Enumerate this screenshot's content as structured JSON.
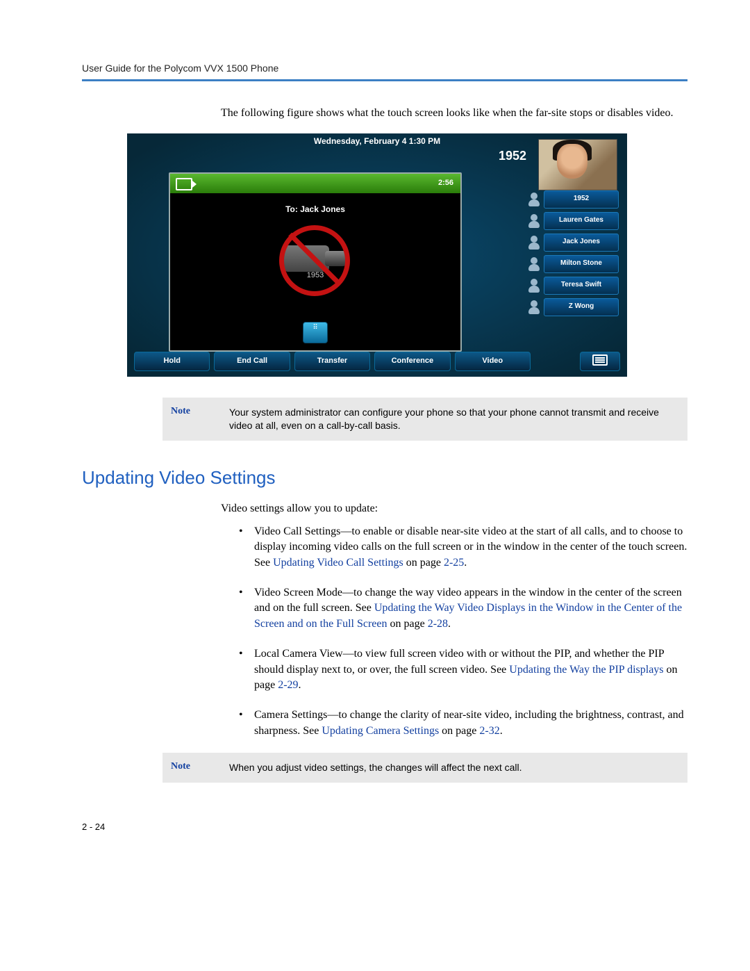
{
  "header": "User Guide for the Polycom VVX 1500 Phone",
  "intro": "The following figure shows what the touch screen looks like when the far-site stops or disables video.",
  "phone": {
    "datetime": "Wednesday, February 4  1:30 PM",
    "extension": "1952",
    "call_time": "2:56",
    "to_label": "To: Jack Jones",
    "caller_number": "1953",
    "contacts": [
      "1952",
      "Lauren Gates",
      "Jack Jones",
      "Milton Stone",
      "Teresa Swift",
      "Z Wong"
    ],
    "softkeys": [
      "Hold",
      "End Call",
      "Transfer",
      "Conference",
      "Video"
    ]
  },
  "note1_label": "Note",
  "note1_text": "Your system administrator can configure your phone so that your phone cannot transmit and receive video at all, even on a call-by-call basis.",
  "section_title": "Updating Video Settings",
  "body_lead": "Video settings allow you to update:",
  "bullets": {
    "b1a": "Video Call Settings—to enable or disable near-site video at the start of all calls, and to choose to display incoming video calls on the full screen or in the window in the center of the touch screen. See ",
    "b1link": "Updating Video Call Settings",
    "b1b": " on page ",
    "b1page": "2-25",
    "b2a": "Video Screen Mode—to change the way video appears in the window in the center of the screen and on the full screen. See ",
    "b2link": "Updating the Way Video Displays in the Window in the Center of the Screen and on the Full Screen",
    "b2b": " on page ",
    "b2page": "2-28",
    "b3a": "Local Camera View—to view full screen video with or without the PIP, and whether the PIP should display next to, or over, the full screen video. See ",
    "b3link": "Updating the Way the PIP displays",
    "b3b": " on page ",
    "b3page": "2-29",
    "b4a": "Camera Settings—to change the clarity of near-site video, including the brightness, contrast, and sharpness. See ",
    "b4link": "Updating Camera Settings",
    "b4b": " on page ",
    "b4page": "2-32"
  },
  "note2_label": "Note",
  "note2_text": "When you adjust video settings, the changes will affect the next call.",
  "page_number": "2 - 24",
  "period": ".",
  "period2": ".",
  "period3": ".",
  "period4": "."
}
